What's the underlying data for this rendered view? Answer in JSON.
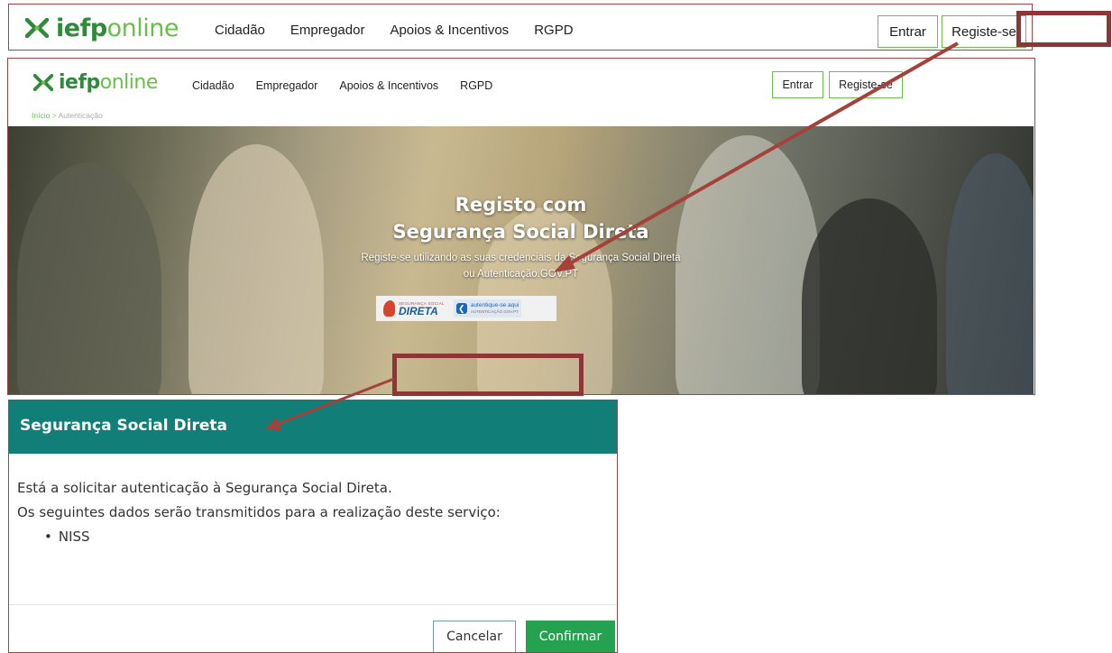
{
  "top_header": {
    "logo_bold": "iefp",
    "logo_light": "online",
    "nav": [
      "Cidadão",
      "Empregador",
      "Apoios & Incentivos",
      "RGPD"
    ],
    "login_label": "Entrar",
    "register_label": "Registe-se"
  },
  "registration_page": {
    "logo_bold": "iefp",
    "logo_light": "online",
    "nav": [
      "Cidadão",
      "Empregador",
      "Apoios & Incentivos",
      "RGPD"
    ],
    "login_label": "Entrar",
    "register_label": "Registe-se",
    "breadcrumb": {
      "home": "Início",
      "separator": ">",
      "current": "Autenticação"
    },
    "hero_title_line1": "Registo com",
    "hero_title_line2": "Segurança Social Direta",
    "hero_sub_line1": "Registe-se utilizando as suas credenciais da Segurança Social Direta",
    "hero_sub_line2": "ou Autenticação.GOV.PT",
    "ssd_small": "SEGURANÇA SOCIAL",
    "ssd_big": "DIRETA",
    "gov_line1": "autentique-se aqui",
    "gov_line2": "AUTENTICAÇÃO.GOV.PT"
  },
  "dialog": {
    "title": "Segurança Social Direta",
    "line1": "Está a solicitar autenticação à Segurança Social Direta.",
    "line2": "Os seguintes dados serão transmitidos para a realização deste serviço:",
    "items": [
      "NISS"
    ],
    "cancel_label": "Cancelar",
    "confirm_label": "Confirmar"
  },
  "colors": {
    "brand_green": "#6abf4b",
    "brand_dark_green": "#2f8a3a",
    "dialog_header": "#117f77",
    "confirm_button": "#25a24f",
    "annotation": "#8e3535"
  }
}
